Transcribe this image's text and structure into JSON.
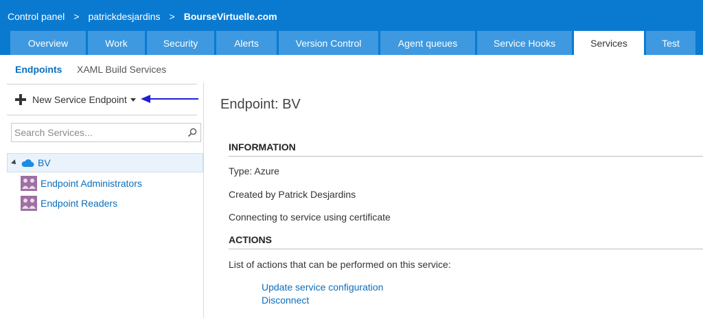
{
  "breadcrumb": {
    "items": [
      "Control panel",
      "patrickdesjardins",
      "BourseVirtuelle.com"
    ],
    "separator": ">"
  },
  "tabs": [
    {
      "label": "Overview"
    },
    {
      "label": "Work"
    },
    {
      "label": "Security"
    },
    {
      "label": "Alerts"
    },
    {
      "label": "Version Control"
    },
    {
      "label": "Agent queues"
    },
    {
      "label": "Service Hooks"
    },
    {
      "label": "Services",
      "active": true
    },
    {
      "label": "Test"
    }
  ],
  "subnav": {
    "items": [
      {
        "label": "Endpoints",
        "active": true
      },
      {
        "label": "XAML Build Services"
      }
    ]
  },
  "left": {
    "new_endpoint_label": "New Service Endpoint",
    "search": {
      "placeholder": "Search Services...",
      "value": ""
    },
    "tree": {
      "root": {
        "label": "BV",
        "icon": "cloud-icon",
        "selected": true
      },
      "children": [
        {
          "label": "Endpoint Administrators",
          "icon": "group-icon"
        },
        {
          "label": "Endpoint Readers",
          "icon": "group-icon"
        }
      ]
    }
  },
  "content": {
    "title": "Endpoint: BV",
    "information": {
      "header": "INFORMATION",
      "lines": [
        "Type: Azure",
        "Created by Patrick Desjardins",
        "Connecting to service using certificate"
      ]
    },
    "actions": {
      "header": "ACTIONS",
      "description": "List of actions that can be performed on this service:",
      "links": [
        "Update service configuration",
        "Disconnect"
      ]
    }
  },
  "colors": {
    "top_bar": "#0a7ad1",
    "tab_inactive": "#3e99e0",
    "tab_active": "#ffffff",
    "link": "#0a6ebd",
    "annotation_arrow": "#1f1fd6",
    "group_icon": "#a06fa3"
  }
}
